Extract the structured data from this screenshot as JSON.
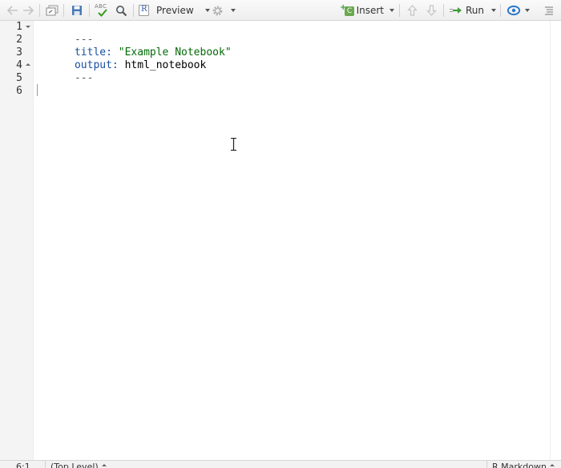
{
  "toolbar": {
    "preview_label": "Preview",
    "insert_label": "Insert",
    "run_label": "Run",
    "spellcheck_label": "ABC",
    "r_badge": "R",
    "c_badge": "C",
    "colors": {
      "insert_green": "#6ba84f",
      "run_green": "#3f9a3a",
      "check_green": "#3a9a1c",
      "publish_blue": "#2a77c9",
      "save_blue": "#4a77b4"
    }
  },
  "editor": {
    "line_numbers": [
      "1",
      "2",
      "3",
      "4",
      "5",
      "6"
    ],
    "lines": {
      "l1": {
        "text": "---"
      },
      "l2": {
        "key": "title:",
        "value": "\"Example Notebook\""
      },
      "l3": {
        "key": "output:",
        "value": "html_notebook"
      },
      "l4": {
        "text": "---"
      }
    }
  },
  "status": {
    "position": "6:1",
    "scope": "(Top Level)",
    "mode": "R Markdown"
  }
}
